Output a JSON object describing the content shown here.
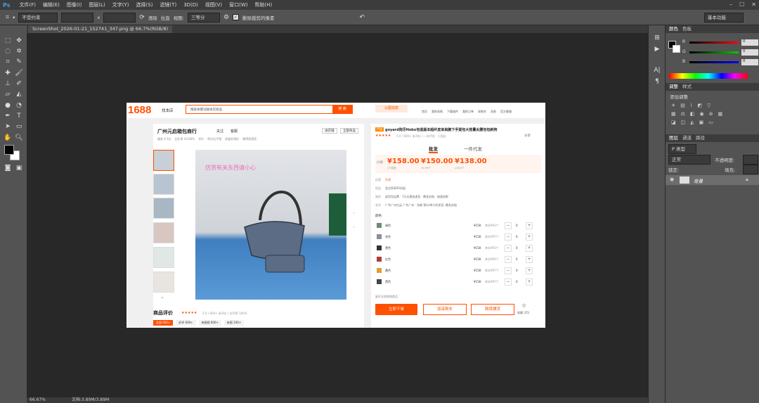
{
  "app": {
    "logo": "Ps",
    "workspace": "基本功能"
  },
  "menu": [
    "文件(F)",
    "编辑(E)",
    "图像(I)",
    "图层(L)",
    "文字(Y)",
    "选择(S)",
    "滤镜(T)",
    "3D(D)",
    "视图(V)",
    "窗口(W)",
    "帮助(H)"
  ],
  "options": {
    "ratio_select": "不受约束",
    "swap_symbol": "x",
    "clear_label": "清除",
    "straighten_label": "拉直",
    "view_label": "视图:",
    "view_select": "三等分",
    "delete_cropped_label": "删除裁剪的像素"
  },
  "document": {
    "tab_title": "ScreenShot_2026-01-21_152741_347.png @ 66.7%(RGB/8)",
    "zoom": "66.67%",
    "doc_info": "文档:3.89M/3.89M"
  },
  "panels": {
    "color_tabs": [
      "颜色",
      "色板"
    ],
    "rgb": [
      {
        "label": "R",
        "value": "0"
      },
      {
        "label": "G",
        "value": "0"
      },
      {
        "label": "B",
        "value": "0"
      }
    ],
    "adjust_tabs": [
      "调整",
      "样式"
    ],
    "adjust_title": "添加调整",
    "layer_tabs": [
      "图层",
      "通道",
      "路径"
    ],
    "kind_label": "P 类型",
    "blend_mode": "正常",
    "opacity_label": "不透明度:",
    "lock_label": "锁定:",
    "fill_label": "填充:",
    "layer_name": "背景"
  },
  "web": {
    "logo": "1688",
    "find_shop": "找本店",
    "search_placeholder": "搜索关键词搜本店商品",
    "search_button": "搜 索",
    "image_search": "以图找款",
    "nav": [
      "首页",
      "我的采购",
      "下载插件",
      "我的订单",
      "采购车",
      "消息",
      "官方客服"
    ],
    "shop_name": "广州元启箱包商行",
    "follow": "关注",
    "contact": "客服",
    "shop_meta": [
      "服务 4.5分",
      "回头率 43.84%",
      "评价",
      "性价比不错",
      "质量非常好",
      "做得很漂亮"
    ],
    "shop_btn1": "进店铺",
    "shop_btn2": "全部商品",
    "image_overlay": "仿货有关东西请小心",
    "review_title": "商品评价",
    "review_stats": "5.0 ( 600+ 条评价 )  好评率 100%",
    "review_tabs": [
      "全部 600+",
      "好评 600+",
      "有图视 600+",
      "有图 100+"
    ],
    "title_badge": "严选",
    "product_title": "goyard狗牙Hobo包逃版本超纤皮单肩腋下手提包大容量女腰包包斜挎",
    "product_meta": "5.0 ( 600+ 条评价 )  一年代发 · 十团店",
    "share": "分享",
    "tabs": [
      "批发",
      "一件代发"
    ],
    "price_label": "价格",
    "prices": [
      {
        "value": "¥158.00",
        "note": "1个起批"
      },
      {
        "value": "¥150.00",
        "note": "10-99个"
      },
      {
        "value": "¥138.00",
        "note": "≥100个"
      }
    ],
    "info_rows": [
      {
        "label": "优惠",
        "value": "先领"
      },
      {
        "label": "权益",
        "value": "会员再享95折起"
      },
      {
        "label": "服务",
        "value": "退货包运费 · 7天无理由退货 · 晚发必赔 · 极速退款"
      },
      {
        "label": "发货",
        "value": "广东广州白云 广东广州 · 包邮  预计48小时发货, 晚发必赔"
      }
    ],
    "color_label": "颜色",
    "skus": [
      {
        "name": "绿色",
        "price": "¥158",
        "stock": "库存993个",
        "qty": "0"
      },
      {
        "name": "灰色",
        "price": "¥158",
        "stock": "库存997个",
        "qty": "0"
      },
      {
        "name": "黑色",
        "price": "¥158",
        "stock": "库存993个",
        "qty": "0"
      },
      {
        "name": "红色",
        "price": "¥158",
        "stock": "库存994个",
        "qty": "0"
      },
      {
        "name": "黄色",
        "price": "¥158",
        "stock": "库存997个",
        "qty": "0"
      },
      {
        "name": "黑色",
        "price": "¥158",
        "stock": "库存997个",
        "qty": "0"
      }
    ],
    "more_skus": "展开全部规格商品",
    "buy_now": "立即下单",
    "add_cart": "加采购车",
    "dropship": "跨境铺货",
    "favorite": "收藏 (45)"
  },
  "colors": {
    "accent": "#ff5000",
    "ps_blue": "#3d9bf0",
    "panel_bg": "#535353"
  }
}
